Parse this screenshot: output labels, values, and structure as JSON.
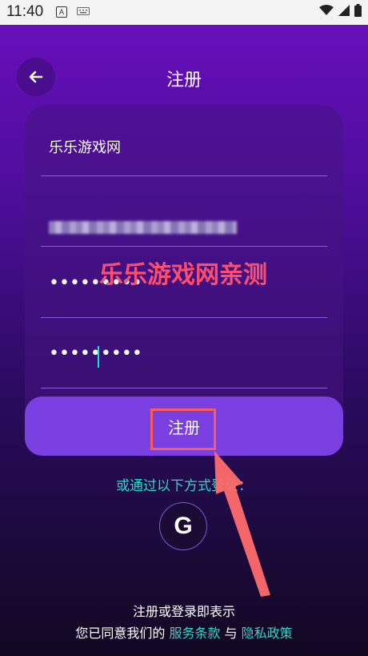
{
  "status_bar": {
    "time": "11:40",
    "a_icon_text": "A",
    "icons": [
      "keyboard-icon",
      "wifi-icon",
      "signal-icon",
      "battery-icon"
    ]
  },
  "header": {
    "title": "注册",
    "back_icon": "arrow-left-icon"
  },
  "form": {
    "username_value": "乐乐游戏网",
    "password_mask": "•••••••••",
    "confirm_password_mask": "•••••••••"
  },
  "watermark": "乐乐游戏网亲测",
  "submit_label": "注册",
  "alt_login_text": "或通过以下方式登录：",
  "google_button": "G",
  "terms": {
    "line1": "注册或登录即表示",
    "line2_prefix": "您已同意我们的 ",
    "service_link": "服务条款",
    "connector": " 与 ",
    "privacy_link": "隐私政策"
  },
  "colors": {
    "accent": "#7a3fe0",
    "link": "#33d7c8",
    "annotation": "#ff5a5a"
  }
}
